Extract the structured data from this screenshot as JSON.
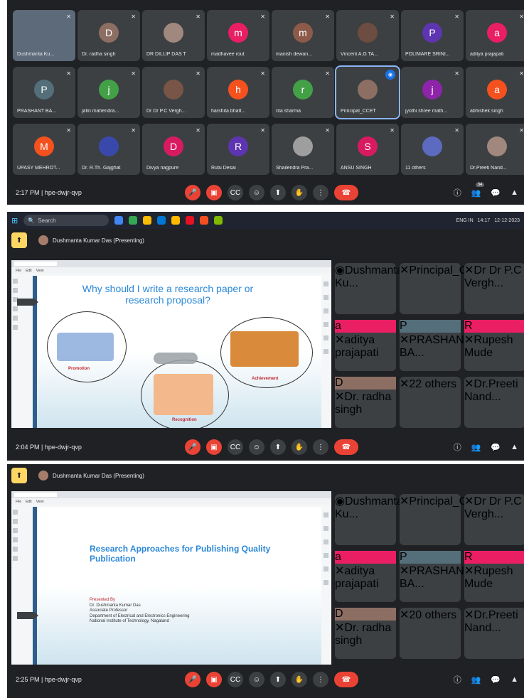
{
  "grid": {
    "tiles": [
      {
        "name": "Dushmanta Ku...",
        "letter": "",
        "color": "",
        "selfie": true
      },
      {
        "name": "Dr. radha singh",
        "letter": "D",
        "color": "#8d6e63"
      },
      {
        "name": "DR DILLIP DAS T",
        "letter": "",
        "color": "#a1887f",
        "photo": true
      },
      {
        "name": "madhavee rout",
        "letter": "m",
        "color": "#e91e63"
      },
      {
        "name": "manish dewan...",
        "letter": "m",
        "color": "#8d5a4a"
      },
      {
        "name": "Vincent A.G TA...",
        "letter": "",
        "color": "#6d4c41",
        "photo": true
      },
      {
        "name": "POLIMARE SRINI...",
        "letter": "P",
        "color": "#5e35b1"
      },
      {
        "name": "aditya prajapati",
        "letter": "a",
        "color": "#e91e63"
      },
      {
        "name": "PRASHANT BA...",
        "letter": "P",
        "color": "#546e7a"
      },
      {
        "name": "jatin mahendra...",
        "letter": "j",
        "color": "#43a047"
      },
      {
        "name": "Dr Dr P.C Vergh...",
        "letter": "",
        "color": "#795548",
        "photo": true
      },
      {
        "name": "harshita bhatt...",
        "letter": "h",
        "color": "#f4511e"
      },
      {
        "name": "rita sharma",
        "letter": "r",
        "color": "#43a047"
      },
      {
        "name": "Principal_CCET",
        "letter": "",
        "color": "#8d6e63",
        "photo": true,
        "active": true
      },
      {
        "name": "jyothi shree math...",
        "letter": "j",
        "color": "#8e24aa"
      },
      {
        "name": "abhishek singh",
        "letter": "a",
        "color": "#f4511e"
      },
      {
        "name": "UPASY MEHROT...",
        "letter": "M",
        "color": "#f4511e"
      },
      {
        "name": "Dr. R.Th. Gajghat",
        "letter": "",
        "color": "#3949ab",
        "photo": true
      },
      {
        "name": "Divya nagpure",
        "letter": "D",
        "color": "#d81b60"
      },
      {
        "name": "Rutu Desai",
        "letter": "R",
        "color": "#5e35b1"
      },
      {
        "name": "Shailendra Pra...",
        "letter": "",
        "color": "#9e9e9e",
        "photo": true
      },
      {
        "name": "ANSU SINGH",
        "letter": "S",
        "color": "#d81b60"
      },
      {
        "name": "11 others",
        "letter": "",
        "color": "#5c6bc0",
        "others": true
      },
      {
        "name": "Dr.Preeti Nand...",
        "letter": "",
        "color": "#a1887f",
        "photo": true
      }
    ],
    "time": "2:17 PM | hpe-dwjr-qvp"
  },
  "taskbar": {
    "search": "Search",
    "time": "14:17",
    "date": "12-12-2023",
    "lang": "ENG IN"
  },
  "share1": {
    "presenter": "Dushmanta Kumar Das (Presenting)",
    "slide_title": "Why should I write a research paper or research proposal?",
    "captions": [
      "Promotion",
      "Recognition",
      "Achievement"
    ],
    "time": "2:04 PM | hpe-dwjr-qvp",
    "tiles": [
      {
        "name": "Dushmanta Ku...",
        "letter": "",
        "color": "#8d6e63",
        "photo": true,
        "active": true
      },
      {
        "name": "Principal_CCET",
        "letter": "",
        "color": "#8d6e63",
        "photo": true
      },
      {
        "name": "Dr Dr P.C Vergh...",
        "letter": "",
        "color": "#795548",
        "photo": true
      },
      {
        "name": "aditya prajapati",
        "letter": "a",
        "color": "#e91e63"
      },
      {
        "name": "PRASHANT BA...",
        "letter": "P",
        "color": "#546e7a"
      },
      {
        "name": "Rupesh Mude",
        "letter": "R",
        "color": "#e91e63"
      },
      {
        "name": "Dr. radha singh",
        "letter": "D",
        "color": "#8d6e63"
      },
      {
        "name": "22 others",
        "letter": "",
        "color": "#5c6bc0",
        "others": true
      },
      {
        "name": "Dr.Preeti Nand...",
        "letter": "",
        "color": "#a1887f",
        "photo": true
      }
    ]
  },
  "share2": {
    "presenter": "Dushmanta Kumar Das (Presenting)",
    "slide_title": "Research Approaches for Publishing Quality Publication",
    "lines": [
      "Presented By",
      "Dr. Dushmanta Kumar Das",
      "Associate Professor",
      "Department of Electrical and Electronics Engineering",
      "National Institute of Technology, Nagaland"
    ],
    "time": "2:25 PM | hpe-dwjr-qvp",
    "tiles": [
      {
        "name": "Dushmanta Ku...",
        "letter": "",
        "color": "#8d6e63",
        "photo": true,
        "active": true
      },
      {
        "name": "Principal_CCET",
        "letter": "",
        "color": "#8d6e63",
        "photo": true
      },
      {
        "name": "Dr Dr P.C Vergh...",
        "letter": "",
        "color": "#795548",
        "photo": true
      },
      {
        "name": "aditya prajapati",
        "letter": "a",
        "color": "#e91e63"
      },
      {
        "name": "PRASHANT BA...",
        "letter": "P",
        "color": "#546e7a"
      },
      {
        "name": "Rupesh Mude",
        "letter": "R",
        "color": "#e91e63"
      },
      {
        "name": "Dr. radha singh",
        "letter": "D",
        "color": "#8d6e63"
      },
      {
        "name": "20 others",
        "letter": "",
        "color": "#5c6bc0",
        "others": true
      },
      {
        "name": "Dr.Preeti Nand...",
        "letter": "",
        "color": "#a1887f",
        "photo": true
      }
    ]
  },
  "participants_count": "34"
}
